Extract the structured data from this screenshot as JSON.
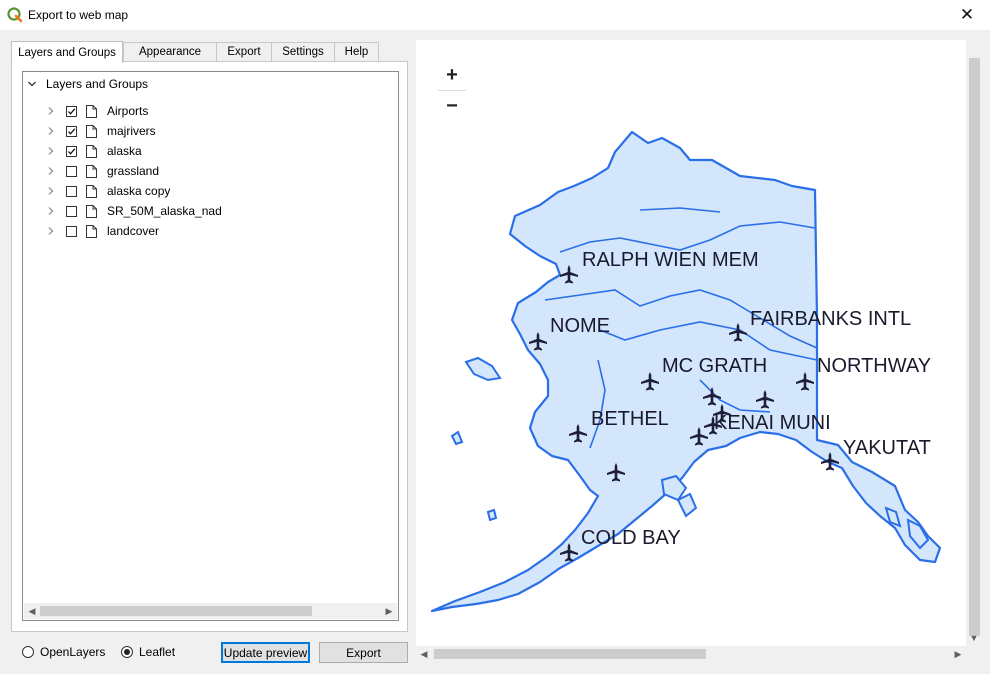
{
  "window": {
    "title": "Export to web map",
    "close_glyph": "✕"
  },
  "tabs": [
    {
      "label": "Layers and Groups",
      "active": true
    },
    {
      "label": "Appearance",
      "active": false
    },
    {
      "label": "Export",
      "active": false
    },
    {
      "label": "Settings",
      "active": false
    },
    {
      "label": "Help",
      "active": false
    }
  ],
  "tree": {
    "root_label": "Layers and Groups",
    "layers": [
      {
        "name": "Airports",
        "checked": true
      },
      {
        "name": "majrivers",
        "checked": true
      },
      {
        "name": "alaska",
        "checked": true
      },
      {
        "name": "grassland",
        "checked": false
      },
      {
        "name": "alaska copy",
        "checked": false
      },
      {
        "name": "SR_50M_alaska_nad",
        "checked": false
      },
      {
        "name": "landcover",
        "checked": false
      }
    ]
  },
  "format": {
    "openlayers_label": "OpenLayers",
    "leaflet_label": "Leaflet",
    "selected": "Leaflet"
  },
  "buttons": {
    "update_preview": "Update preview",
    "export": "Export"
  },
  "map": {
    "zoom_in": "+",
    "zoom_out": "−",
    "land_fill": "#d4e6fb",
    "outline_color": "#2a6fe8",
    "airport_color": "#1e1e3a",
    "labels": [
      {
        "text": "RALPH WIEN MEM"
      },
      {
        "text": "NOME"
      },
      {
        "text": "FAIRBANKS INTL"
      },
      {
        "text": "MC GRATH"
      },
      {
        "text": "NORTHWAY"
      },
      {
        "text": "BETHEL"
      },
      {
        "text": "KENAI MUNI"
      },
      {
        "text": "YAKUTAT"
      },
      {
        "text": "COLD BAY"
      }
    ]
  }
}
